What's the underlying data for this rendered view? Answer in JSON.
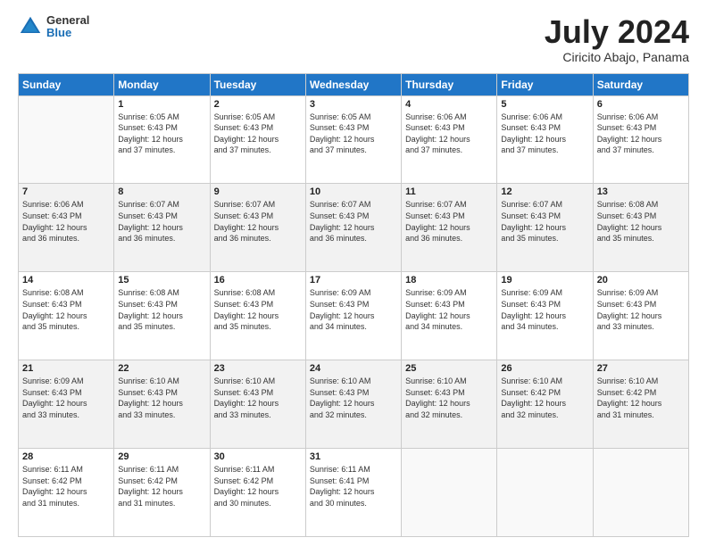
{
  "header": {
    "logo_general": "General",
    "logo_blue": "Blue",
    "month": "July 2024",
    "location": "Ciricito Abajo, Panama"
  },
  "days_of_week": [
    "Sunday",
    "Monday",
    "Tuesday",
    "Wednesday",
    "Thursday",
    "Friday",
    "Saturday"
  ],
  "weeks": [
    [
      {
        "day": "",
        "info": ""
      },
      {
        "day": "1",
        "info": "Sunrise: 6:05 AM\nSunset: 6:43 PM\nDaylight: 12 hours\nand 37 minutes."
      },
      {
        "day": "2",
        "info": "Sunrise: 6:05 AM\nSunset: 6:43 PM\nDaylight: 12 hours\nand 37 minutes."
      },
      {
        "day": "3",
        "info": "Sunrise: 6:05 AM\nSunset: 6:43 PM\nDaylight: 12 hours\nand 37 minutes."
      },
      {
        "day": "4",
        "info": "Sunrise: 6:06 AM\nSunset: 6:43 PM\nDaylight: 12 hours\nand 37 minutes."
      },
      {
        "day": "5",
        "info": "Sunrise: 6:06 AM\nSunset: 6:43 PM\nDaylight: 12 hours\nand 37 minutes."
      },
      {
        "day": "6",
        "info": "Sunrise: 6:06 AM\nSunset: 6:43 PM\nDaylight: 12 hours\nand 37 minutes."
      }
    ],
    [
      {
        "day": "7",
        "info": "Sunrise: 6:06 AM\nSunset: 6:43 PM\nDaylight: 12 hours\nand 36 minutes."
      },
      {
        "day": "8",
        "info": "Sunrise: 6:07 AM\nSunset: 6:43 PM\nDaylight: 12 hours\nand 36 minutes."
      },
      {
        "day": "9",
        "info": "Sunrise: 6:07 AM\nSunset: 6:43 PM\nDaylight: 12 hours\nand 36 minutes."
      },
      {
        "day": "10",
        "info": "Sunrise: 6:07 AM\nSunset: 6:43 PM\nDaylight: 12 hours\nand 36 minutes."
      },
      {
        "day": "11",
        "info": "Sunrise: 6:07 AM\nSunset: 6:43 PM\nDaylight: 12 hours\nand 36 minutes."
      },
      {
        "day": "12",
        "info": "Sunrise: 6:07 AM\nSunset: 6:43 PM\nDaylight: 12 hours\nand 35 minutes."
      },
      {
        "day": "13",
        "info": "Sunrise: 6:08 AM\nSunset: 6:43 PM\nDaylight: 12 hours\nand 35 minutes."
      }
    ],
    [
      {
        "day": "14",
        "info": "Sunrise: 6:08 AM\nSunset: 6:43 PM\nDaylight: 12 hours\nand 35 minutes."
      },
      {
        "day": "15",
        "info": "Sunrise: 6:08 AM\nSunset: 6:43 PM\nDaylight: 12 hours\nand 35 minutes."
      },
      {
        "day": "16",
        "info": "Sunrise: 6:08 AM\nSunset: 6:43 PM\nDaylight: 12 hours\nand 35 minutes."
      },
      {
        "day": "17",
        "info": "Sunrise: 6:09 AM\nSunset: 6:43 PM\nDaylight: 12 hours\nand 34 minutes."
      },
      {
        "day": "18",
        "info": "Sunrise: 6:09 AM\nSunset: 6:43 PM\nDaylight: 12 hours\nand 34 minutes."
      },
      {
        "day": "19",
        "info": "Sunrise: 6:09 AM\nSunset: 6:43 PM\nDaylight: 12 hours\nand 34 minutes."
      },
      {
        "day": "20",
        "info": "Sunrise: 6:09 AM\nSunset: 6:43 PM\nDaylight: 12 hours\nand 33 minutes."
      }
    ],
    [
      {
        "day": "21",
        "info": "Sunrise: 6:09 AM\nSunset: 6:43 PM\nDaylight: 12 hours\nand 33 minutes."
      },
      {
        "day": "22",
        "info": "Sunrise: 6:10 AM\nSunset: 6:43 PM\nDaylight: 12 hours\nand 33 minutes."
      },
      {
        "day": "23",
        "info": "Sunrise: 6:10 AM\nSunset: 6:43 PM\nDaylight: 12 hours\nand 33 minutes."
      },
      {
        "day": "24",
        "info": "Sunrise: 6:10 AM\nSunset: 6:43 PM\nDaylight: 12 hours\nand 32 minutes."
      },
      {
        "day": "25",
        "info": "Sunrise: 6:10 AM\nSunset: 6:43 PM\nDaylight: 12 hours\nand 32 minutes."
      },
      {
        "day": "26",
        "info": "Sunrise: 6:10 AM\nSunset: 6:42 PM\nDaylight: 12 hours\nand 32 minutes."
      },
      {
        "day": "27",
        "info": "Sunrise: 6:10 AM\nSunset: 6:42 PM\nDaylight: 12 hours\nand 31 minutes."
      }
    ],
    [
      {
        "day": "28",
        "info": "Sunrise: 6:11 AM\nSunset: 6:42 PM\nDaylight: 12 hours\nand 31 minutes."
      },
      {
        "day": "29",
        "info": "Sunrise: 6:11 AM\nSunset: 6:42 PM\nDaylight: 12 hours\nand 31 minutes."
      },
      {
        "day": "30",
        "info": "Sunrise: 6:11 AM\nSunset: 6:42 PM\nDaylight: 12 hours\nand 30 minutes."
      },
      {
        "day": "31",
        "info": "Sunrise: 6:11 AM\nSunset: 6:41 PM\nDaylight: 12 hours\nand 30 minutes."
      },
      {
        "day": "",
        "info": ""
      },
      {
        "day": "",
        "info": ""
      },
      {
        "day": "",
        "info": ""
      }
    ]
  ]
}
